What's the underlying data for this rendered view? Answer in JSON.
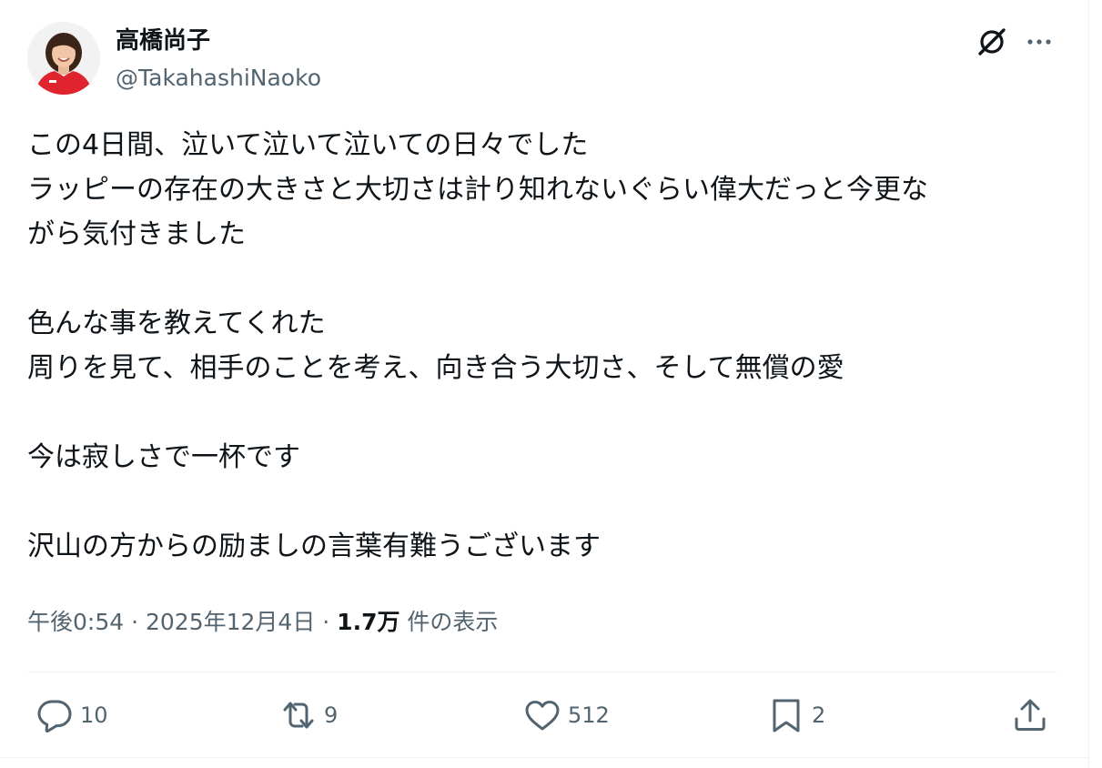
{
  "author": {
    "display_name": "高橋尚子",
    "handle": "@TakahashiNaoko"
  },
  "header_icons": {
    "grok": "grok-icon",
    "more": "more-icon"
  },
  "tweet": {
    "lines": [
      "この4日間、泣いて泣いて泣いての日々でした",
      "ラッピーの存在の大きさと大切さは計り知れないぐらい偉大だっと今更な",
      "がら気付きました",
      "",
      "色んな事を教えてくれた",
      "周りを見て、相手のことを考え、向き合う大切さ、そして無償の愛",
      "",
      "今は寂しさで一杯です",
      "",
      "沢山の方からの励ましの言葉有難うございます"
    ]
  },
  "meta": {
    "time": "午後0:54",
    "separator": " · ",
    "date": "2025年12月4日",
    "views_count": "1.7万",
    "views_label": "件の表示"
  },
  "actions": {
    "reply_count": "10",
    "repost_count": "9",
    "like_count": "512",
    "bookmark_count": "2"
  },
  "colors": {
    "text": "#0f1419",
    "secondary": "#536471",
    "border": "#eff3f4"
  }
}
